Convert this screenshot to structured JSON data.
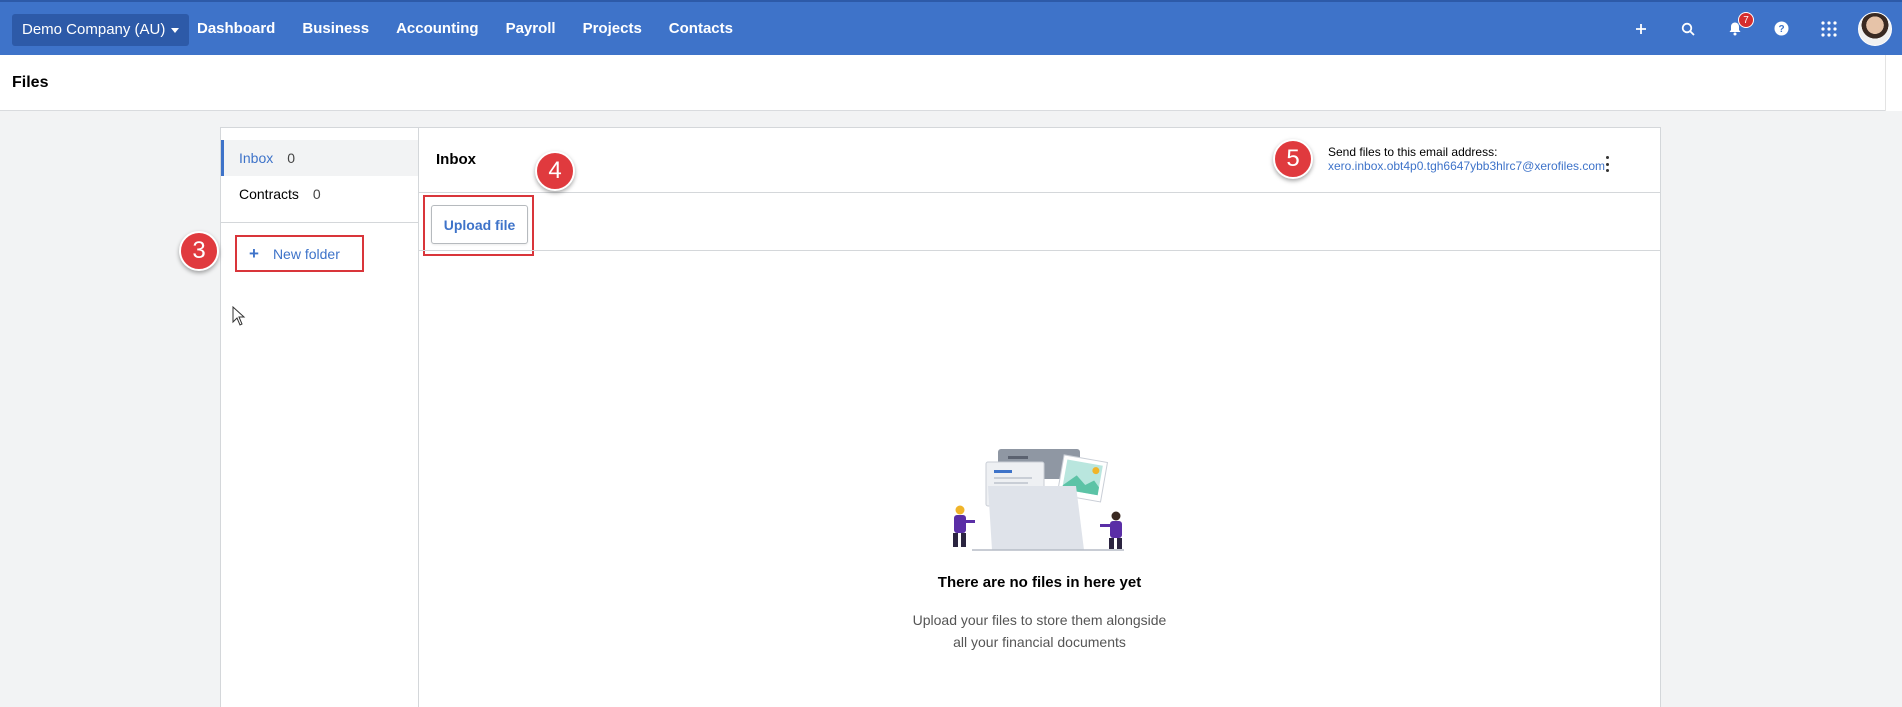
{
  "topbar": {
    "org_label": "Demo Company (AU)",
    "nav": [
      "Dashboard",
      "Business",
      "Accounting",
      "Payroll",
      "Projects",
      "Contacts"
    ],
    "icons": [
      "plus-icon",
      "search-icon",
      "bell-icon",
      "help-icon",
      "apps-grid-icon",
      "avatar"
    ],
    "notification_count": "7"
  },
  "page": {
    "title": "Files"
  },
  "sidebar": {
    "folders": [
      {
        "label": "Inbox",
        "count": "0",
        "active": true
      },
      {
        "label": "Contracts",
        "count": "0",
        "active": false
      }
    ],
    "new_folder_label": "New folder"
  },
  "content": {
    "title": "Inbox",
    "upload_label": "Upload file",
    "email_label": "Send files to this email address:",
    "email_address": "xero.inbox.obt4p0.tgh6647ybb3hlrc7@xerofiles.com",
    "empty_title": "There are no files in here yet",
    "empty_sub_line1": "Upload your files to store them alongside",
    "empty_sub_line2": "all your financial documents"
  },
  "markers": [
    "3",
    "4",
    "5"
  ],
  "colors": {
    "brand": "#3e73c9",
    "callout": "#e03a3e"
  }
}
